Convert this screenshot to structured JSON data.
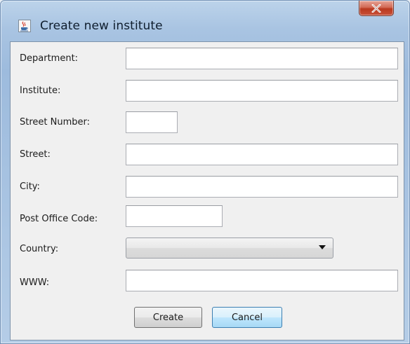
{
  "window": {
    "title": "Create new institute",
    "close_symbol": "X"
  },
  "icons": {
    "app": "java-cup-icon",
    "close": "close-icon",
    "dropdown": "chevron-down-icon"
  },
  "form": {
    "department": {
      "label": "Department:",
      "value": ""
    },
    "institute": {
      "label": "Institute:",
      "value": ""
    },
    "street_number": {
      "label": "Street Number:",
      "value": ""
    },
    "street": {
      "label": "Street:",
      "value": ""
    },
    "city": {
      "label": "City:",
      "value": ""
    },
    "post_office_code": {
      "label": "Post Office Code:",
      "value": ""
    },
    "country": {
      "label": "Country:",
      "selected": ""
    },
    "www": {
      "label": "WWW:",
      "value": ""
    }
  },
  "buttons": {
    "create": "Create",
    "cancel": "Cancel"
  },
  "colors": {
    "titlebar": "#a9c4e2",
    "close_button": "#c8513a",
    "dialog_background": "#f0f0f0",
    "focused_button": "#bee6fd"
  }
}
